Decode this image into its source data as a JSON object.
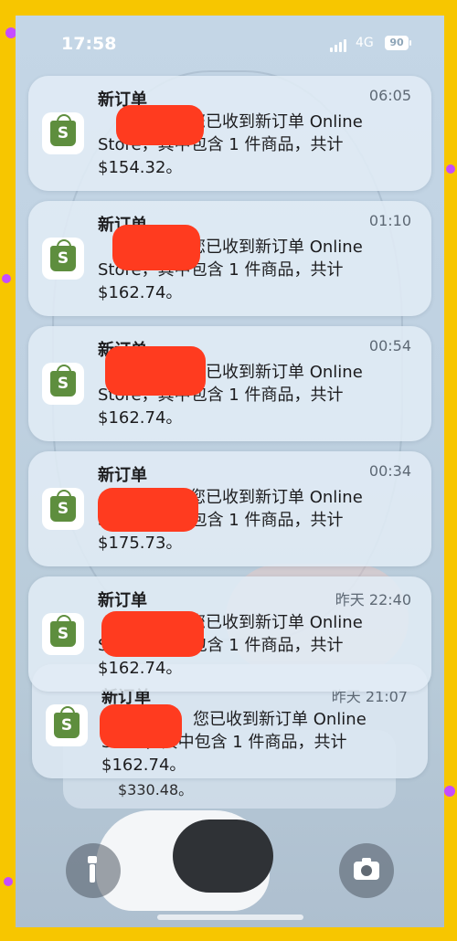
{
  "status_bar": {
    "time": "17:58",
    "network": "4G",
    "battery": "90"
  },
  "notifications": [
    {
      "title": "新订单",
      "time": "06:05",
      "line1": "您已收到新订单 Online",
      "line2": "Store，其中包含 1 件商品，共计",
      "line3": "$154.32。"
    },
    {
      "title": "新订单",
      "time": "01:10",
      "line1": "您已收到新订单 Online",
      "line2": "Store，其中包含 1 件商品，共计",
      "line3": "$162.74。"
    },
    {
      "title": "新订单",
      "time": "00:54",
      "line1": "您已收到新订单 Online",
      "line2": "Store，其中包含 1 件商品，共计",
      "line3": "$162.74。"
    },
    {
      "title": "新订单",
      "time": "00:34",
      "line1": "您已收到新订单 Online",
      "line2": "Store，其中包含 1 件商品，共计",
      "line3": "$175.73。"
    },
    {
      "title": "新订单",
      "time": "昨天 22:40",
      "line1": "您已收到新订单 Online",
      "line2": "Store，其中包含 1 件商品，共计",
      "line3": "$162.74。"
    },
    {
      "title": "新订单",
      "time": "昨天 21:07",
      "line1": "您已收到新订单 Online",
      "line2": "Store，其中包含 1 件商品，共计",
      "line3": "$162.74。"
    }
  ],
  "stacked_hint": {
    "amount": "$330.48。"
  },
  "icons": {
    "app_icon": "shopify-bag-icon",
    "flashlight": "flashlight-icon",
    "camera": "camera-icon"
  },
  "colors": {
    "frame": "#f7c600",
    "shopify_green": "#5e8e3e",
    "redaction": "#ff3b1f"
  }
}
